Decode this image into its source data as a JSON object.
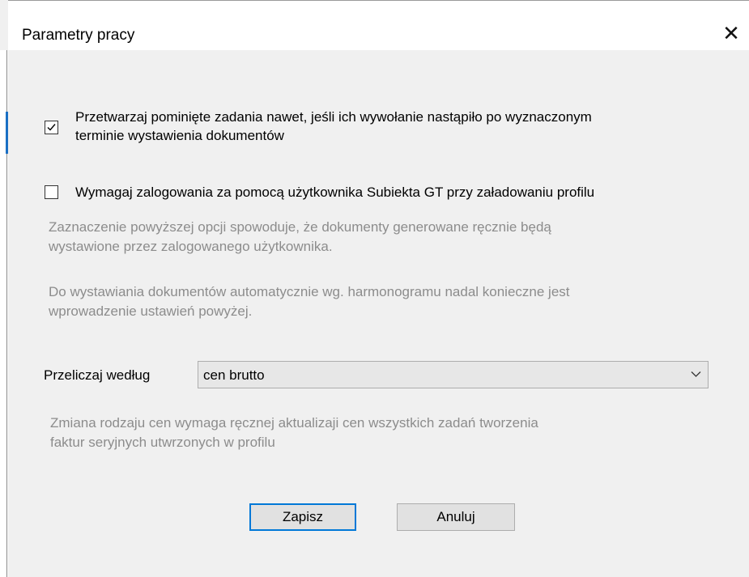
{
  "dialog": {
    "title": "Parametry pracy",
    "close_icon": "✕"
  },
  "options": {
    "process_skipped": {
      "checked": true,
      "label_line1": "Przetwarzaj pominięte zadania nawet, jeśli ich wywołanie nastąpiło po wyznaczonym",
      "label_line2": "terminie wystawienia dokumentów"
    },
    "require_login": {
      "checked": false,
      "label": "Wymagaj zalogowania za pomocą użytkownika Subiekta GT przy załadowaniu profilu"
    },
    "hint1_line1": "Zaznaczenie powyższej opcji spowoduje, że dokumenty generowane ręcznie będą",
    "hint1_line2": "wystawione przez zalogowanego użytkownika.",
    "hint2_line1": "Do wystawiania dokumentów automatycznie wg. harmonogramu nadal konieczne jest",
    "hint2_line2": "wprowadzenie ustawień powyżej."
  },
  "pricing": {
    "label": "Przeliczaj według",
    "selected": "cen brutto",
    "hint_line1": "Zmiana rodzaju cen wymaga ręcznej aktualizaji cen wszystkich zadań tworzenia",
    "hint_line2": "faktur seryjnych utwrzonych w profilu"
  },
  "buttons": {
    "save": "Zapisz",
    "cancel": "Anuluj"
  },
  "colors": {
    "focus_border": "#0078d7",
    "hint_text": "#8c8c8c",
    "dialog_bg": "#f0f0f0"
  }
}
